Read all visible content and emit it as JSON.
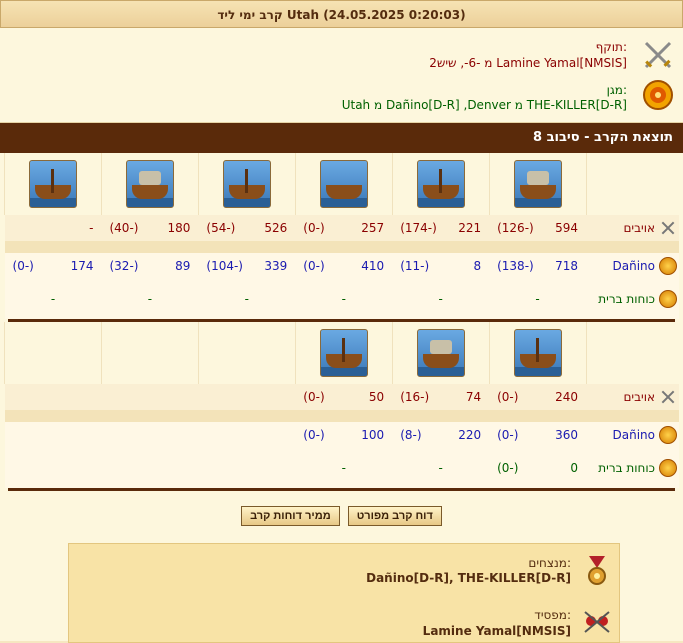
{
  "header": {
    "title": "קרב ימי ליד Utah (24.05.2025 0:20:03)"
  },
  "attacker": {
    "label": "תוקף:",
    "value": "Lamine Yamal[NMSIS] מ -6-, שיש2"
  },
  "defender": {
    "label": "מגן:",
    "value": "THE-KILLER[D-R] מ Dañino[D-R] ,Denver מ Utah"
  },
  "round": {
    "title": "תוצאת הקרב - סיבוב 8"
  },
  "labels": {
    "enemies": "אויבים",
    "own": "Dañino",
    "ally": "כוחות ברית"
  },
  "section1": {
    "enemies": [
      [
        "594",
        "(-126)"
      ],
      [
        "221",
        "(-174)"
      ],
      [
        "257",
        "(-0)"
      ],
      [
        "526",
        "(-54)"
      ],
      [
        "180",
        "(-40)"
      ],
      [
        "-",
        ""
      ]
    ],
    "own": [
      [
        "718",
        "(-138)"
      ],
      [
        "8",
        "(-11)"
      ],
      [
        "410",
        "(-0)"
      ],
      [
        "339",
        "(-104)"
      ],
      [
        "89",
        "(-32)"
      ],
      [
        "174",
        "(-0)"
      ]
    ],
    "ally": [
      "-",
      "-",
      "-",
      "-",
      "-",
      "-"
    ]
  },
  "section2": {
    "enemies": [
      [
        "240",
        "(-0)"
      ],
      [
        "74",
        "(-16)"
      ],
      [
        "50",
        "(-0)"
      ]
    ],
    "own": [
      [
        "360",
        "(-0)"
      ],
      [
        "220",
        "(-8)"
      ],
      [
        "100",
        "(-0)"
      ]
    ],
    "ally": [
      [
        "0",
        "(-0)"
      ],
      [
        "-",
        ""
      ],
      [
        "-",
        ""
      ]
    ]
  },
  "buttons": {
    "detailed": "דוח קרב מפורט",
    "converter": "ממיר דוחות קרב"
  },
  "summary": {
    "winners_label": "מנצחים:",
    "winners_value": "Dañino[D-R], THE-KILLER[D-R]",
    "loser_label": "מפסיד:",
    "loser_value": "Lamine Yamal[NMSIS]"
  },
  "icons": {
    "attacker": "crossed-swords-icon",
    "defender": "shield-icon",
    "winners": "medal-icon",
    "loser": "defeat-icon"
  }
}
